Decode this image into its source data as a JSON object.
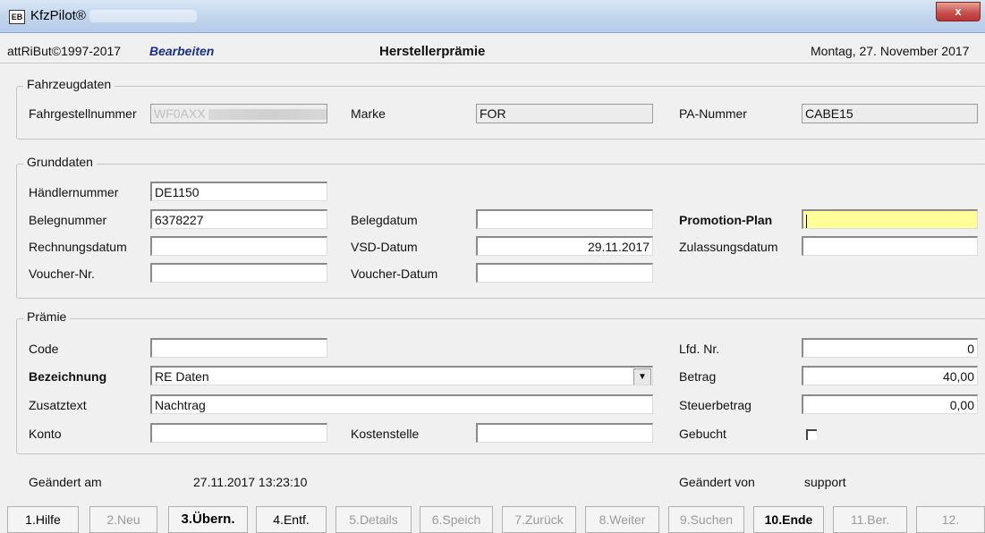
{
  "window": {
    "title": "KfzPilot®",
    "icon": "app-window-icon",
    "close_label": "x"
  },
  "header": {
    "copyright": "attRiBut©1997-2017",
    "mode": "Bearbeiten",
    "page_title": "Herstellerprämie",
    "date": "Montag, 27. November 2017"
  },
  "fahrzeugdaten": {
    "legend": "Fahrzeugdaten",
    "fahrgestellnummer_label": "Fahrgestellnummer",
    "fahrgestellnummer_value": "WF0AXX",
    "marke_label": "Marke",
    "marke_value": "FOR",
    "pa_nummer_label": "PA-Nummer",
    "pa_nummer_value": "CABE15"
  },
  "grunddaten": {
    "legend": "Grunddaten",
    "haendlernummer_label": "Händlernummer",
    "haendlernummer_value": "DE1150",
    "belegnummer_label": "Belegnummer",
    "belegnummer_value": "6378227",
    "belegdatum_label": "Belegdatum",
    "belegdatum_value": "",
    "promotion_plan_label": "Promotion-Plan",
    "promotion_plan_value": "",
    "rechnungsdatum_label": "Rechnungsdatum",
    "rechnungsdatum_value": "",
    "vsd_datum_label": "VSD-Datum",
    "vsd_datum_value": "29.11.2017",
    "zulassungsdatum_label": "Zulassungsdatum",
    "zulassungsdatum_value": "",
    "voucher_nr_label": "Voucher-Nr.",
    "voucher_nr_value": "",
    "voucher_datum_label": "Voucher-Datum",
    "voucher_datum_value": ""
  },
  "praemie": {
    "legend": "Prämie",
    "code_label": "Code",
    "code_value": "",
    "lfd_nr_label": "Lfd. Nr.",
    "lfd_nr_value": "0",
    "bezeichnung_label": "Bezeichnung",
    "bezeichnung_value": "RE Daten",
    "betrag_label": "Betrag",
    "betrag_value": "40,00",
    "zusatztext_label": "Zusatztext",
    "zusatztext_value": "Nachtrag",
    "steuerbetrag_label": "Steuerbetrag",
    "steuerbetrag_value": "0,00",
    "konto_label": "Konto",
    "konto_value": "",
    "kostenstelle_label": "Kostenstelle",
    "kostenstelle_value": "",
    "gebucht_label": "Gebucht",
    "gebucht_checked": false
  },
  "footer": {
    "geaendert_am_label": "Geändert am",
    "geaendert_am_value": "27.11.2017 13:23:10",
    "geaendert_von_label": "Geändert von",
    "geaendert_von_value": "support"
  },
  "function_keys": [
    {
      "label": "1.Hilfe",
      "enabled": true
    },
    {
      "label": "2.Neu",
      "enabled": false
    },
    {
      "label": "3.Übern.",
      "enabled": true
    },
    {
      "label": "4.Entf.",
      "enabled": true
    },
    {
      "label": "5.Details",
      "enabled": false
    },
    {
      "label": "6.Speich",
      "enabled": false
    },
    {
      "label": "7.Zurück",
      "enabled": false
    },
    {
      "label": "8.Weiter",
      "enabled": false
    },
    {
      "label": "9.Suchen",
      "enabled": false
    },
    {
      "label": "10.Ende",
      "enabled": true
    },
    {
      "label": "11.Ber.",
      "enabled": false
    },
    {
      "label": "12.",
      "enabled": false
    }
  ],
  "colors": {
    "highlight_field": "#ffff99",
    "mode_text": "#1a2e8c"
  }
}
